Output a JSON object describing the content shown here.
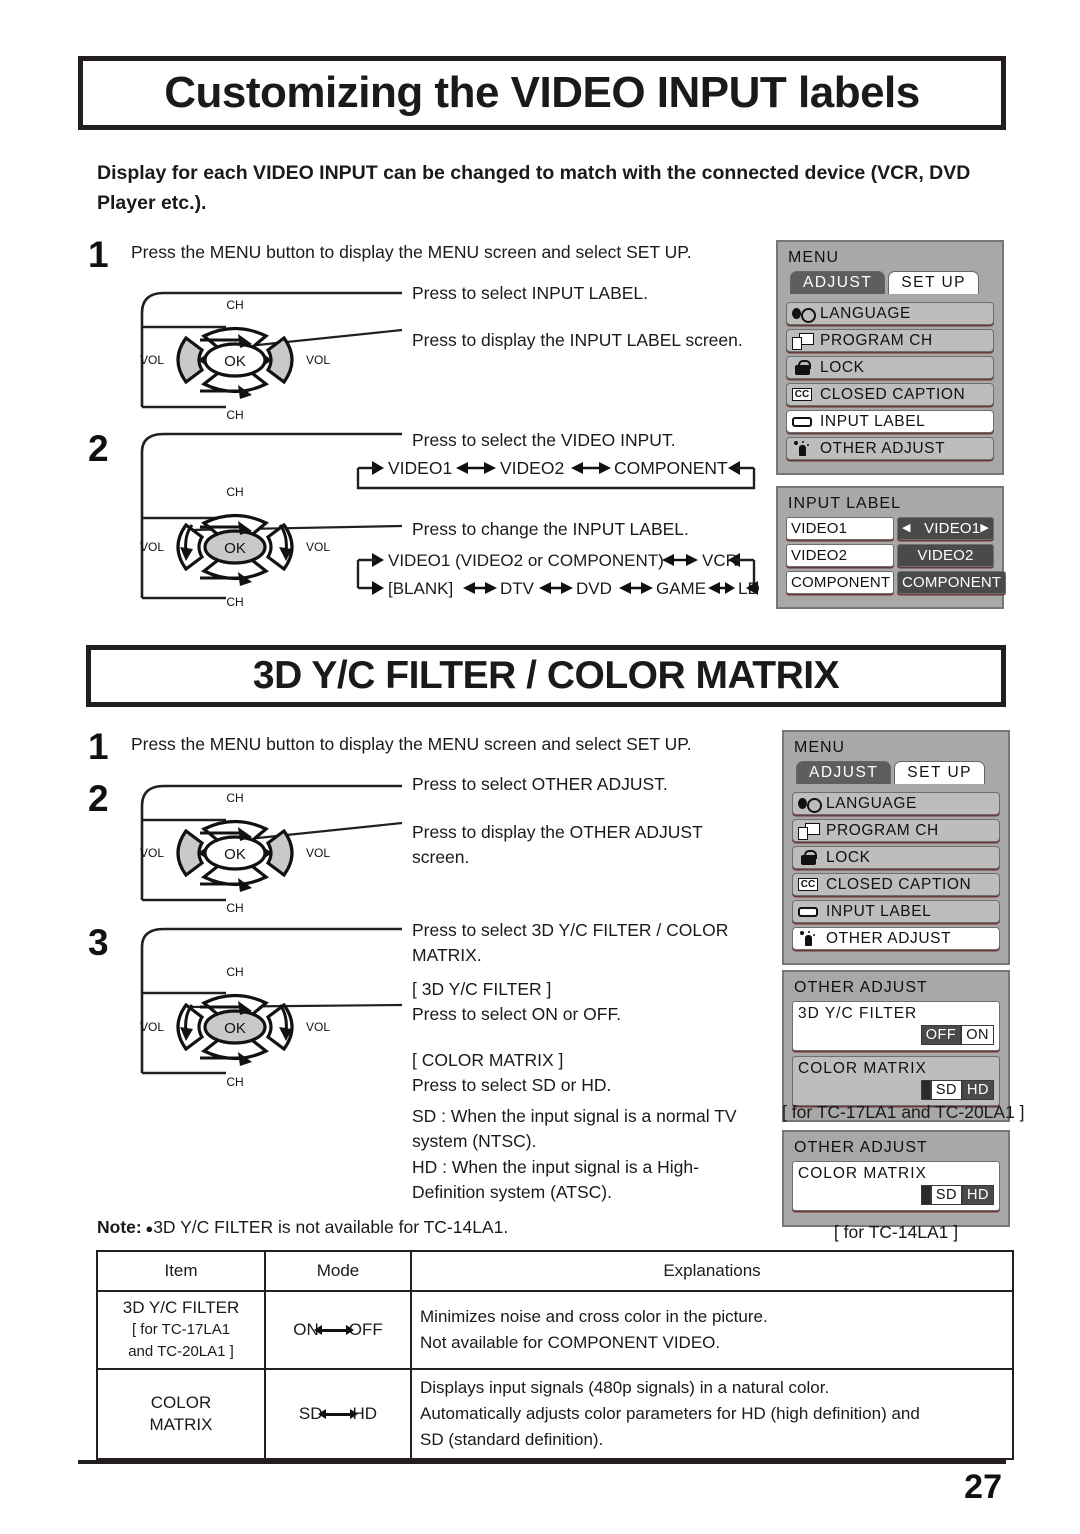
{
  "section1": {
    "title": "Customizing the VIDEO INPUT labels",
    "intro": "Display for each VIDEO INPUT can be changed to match with the connected device (VCR, DVD Player etc.).",
    "steps": [
      {
        "num": "1",
        "text": "Press the MENU button to display the MENU screen and select SET UP."
      },
      {
        "num": "2",
        "text": ""
      }
    ],
    "callouts": {
      "select_input_label": "Press to select INPUT LABEL.",
      "display_input_label": "Press to display the INPUT LABEL screen.",
      "select_video_input": "Press to select the VIDEO INPUT.",
      "change_input_label": "Press to change the INPUT LABEL."
    },
    "flow_video_input": [
      "VIDEO1",
      "VIDEO2",
      "COMPONENT"
    ],
    "flow_input_label_row1": [
      "VIDEO1 (VIDEO2 or COMPONENT)",
      "VCR"
    ],
    "flow_input_label_row2": [
      "[BLANK]",
      "DTV",
      "DVD",
      "GAME",
      "LD"
    ]
  },
  "section2": {
    "title": "3D Y/C FILTER / COLOR MATRIX",
    "steps": [
      {
        "num": "1",
        "text": "Press the MENU button to display the MENU screen and select SET UP."
      },
      {
        "num": "2",
        "text": ""
      },
      {
        "num": "3",
        "text": ""
      }
    ],
    "callouts": {
      "select_other_adjust": "Press to select OTHER ADJUST.",
      "display_other_adjust": "Press to display the OTHER ADJUST screen.",
      "select_filter_matrix": "Press to select 3D Y/C FILTER / COLOR MATRIX.",
      "filter_head": "[ 3D Y/C FILTER ]",
      "filter_body": "Press to select ON or OFF.",
      "matrix_head": "[ COLOR MATRIX ]",
      "matrix_body": "Press to select SD or HD.",
      "sd_def": "SD : When the input signal is a normal TV system (NTSC).",
      "hd_def": "HD : When the input signal is a High-Definition system (ATSC)."
    },
    "note_label": "Note:",
    "note_text": "3D Y/C FILTER is not available for TC-14LA1."
  },
  "osd_menu": {
    "title": "MENU",
    "tab_adjust": "ADJUST",
    "tab_setup": "SET UP",
    "items": [
      {
        "icon": "language-icon",
        "label": "LANGUAGE"
      },
      {
        "icon": "program-ch-icon",
        "label": "PROGRAM  CH"
      },
      {
        "icon": "lock-icon",
        "label": "LOCK"
      },
      {
        "icon": "closed-caption-icon",
        "label": "CLOSED  CAPTION"
      },
      {
        "icon": "input-label-icon",
        "label": "INPUT  LABEL"
      },
      {
        "icon": "other-adjust-icon",
        "label": "OTHER  ADJUST"
      }
    ],
    "selected_first": "INPUT  LABEL",
    "selected_second": "OTHER  ADJUST"
  },
  "osd_input_label": {
    "title": "INPUT  LABEL",
    "rows": [
      {
        "name": "VIDEO1",
        "value": "VIDEO1",
        "arrows": true
      },
      {
        "name": "VIDEO2",
        "value": "VIDEO2",
        "arrows": false
      },
      {
        "name": "COMPONENT",
        "value": "COMPONENT",
        "arrows": false
      }
    ],
    "left_arrow": "◀",
    "right_arrow": "▶"
  },
  "osd_other_adjust_1": {
    "title": "OTHER  ADJUST",
    "filter_label": "3D  Y/C  FILTER",
    "filter_options": [
      "OFF",
      "ON"
    ],
    "filter_selected": "ON",
    "matrix_label": "COLOR  MATRIX",
    "matrix_options": [
      "SD",
      "HD"
    ],
    "matrix_selected": "SD",
    "caption": "[ for TC-17LA1 and TC-20LA1 ]"
  },
  "osd_other_adjust_2": {
    "title": "OTHER  ADJUST",
    "matrix_label": "COLOR  MATRIX",
    "matrix_options": [
      "SD",
      "HD"
    ],
    "matrix_selected": "SD",
    "caption": "[ for TC-14LA1 ]"
  },
  "dpad": {
    "ch_top": "CH",
    "ch_bottom": "CH",
    "vol_left": "VOL",
    "vol_right": "VOL",
    "ok": "OK"
  },
  "spec_table": {
    "headers": [
      "Item",
      "Mode",
      "Explanations"
    ],
    "rows": [
      {
        "item": "3D Y/C FILTER",
        "item_sub1": "[ for TC-17LA1",
        "item_sub2": "and TC-20LA1 ]",
        "mode_left": "ON",
        "mode_right": "OFF",
        "explanation_1": "Minimizes noise and cross color in the picture.",
        "explanation_2": "Not available for COMPONENT VIDEO.",
        "explanation_3": ""
      },
      {
        "item": "COLOR",
        "item_sub1": "MATRIX",
        "item_sub2": "",
        "mode_left": "SD",
        "mode_right": "HD",
        "explanation_1": "Displays input signals (480p signals) in a natural color.",
        "explanation_2": "Automatically adjusts color parameters for HD (high definition) and",
        "explanation_3": "SD (standard definition)."
      }
    ]
  },
  "footer": {
    "page_number": "27"
  }
}
